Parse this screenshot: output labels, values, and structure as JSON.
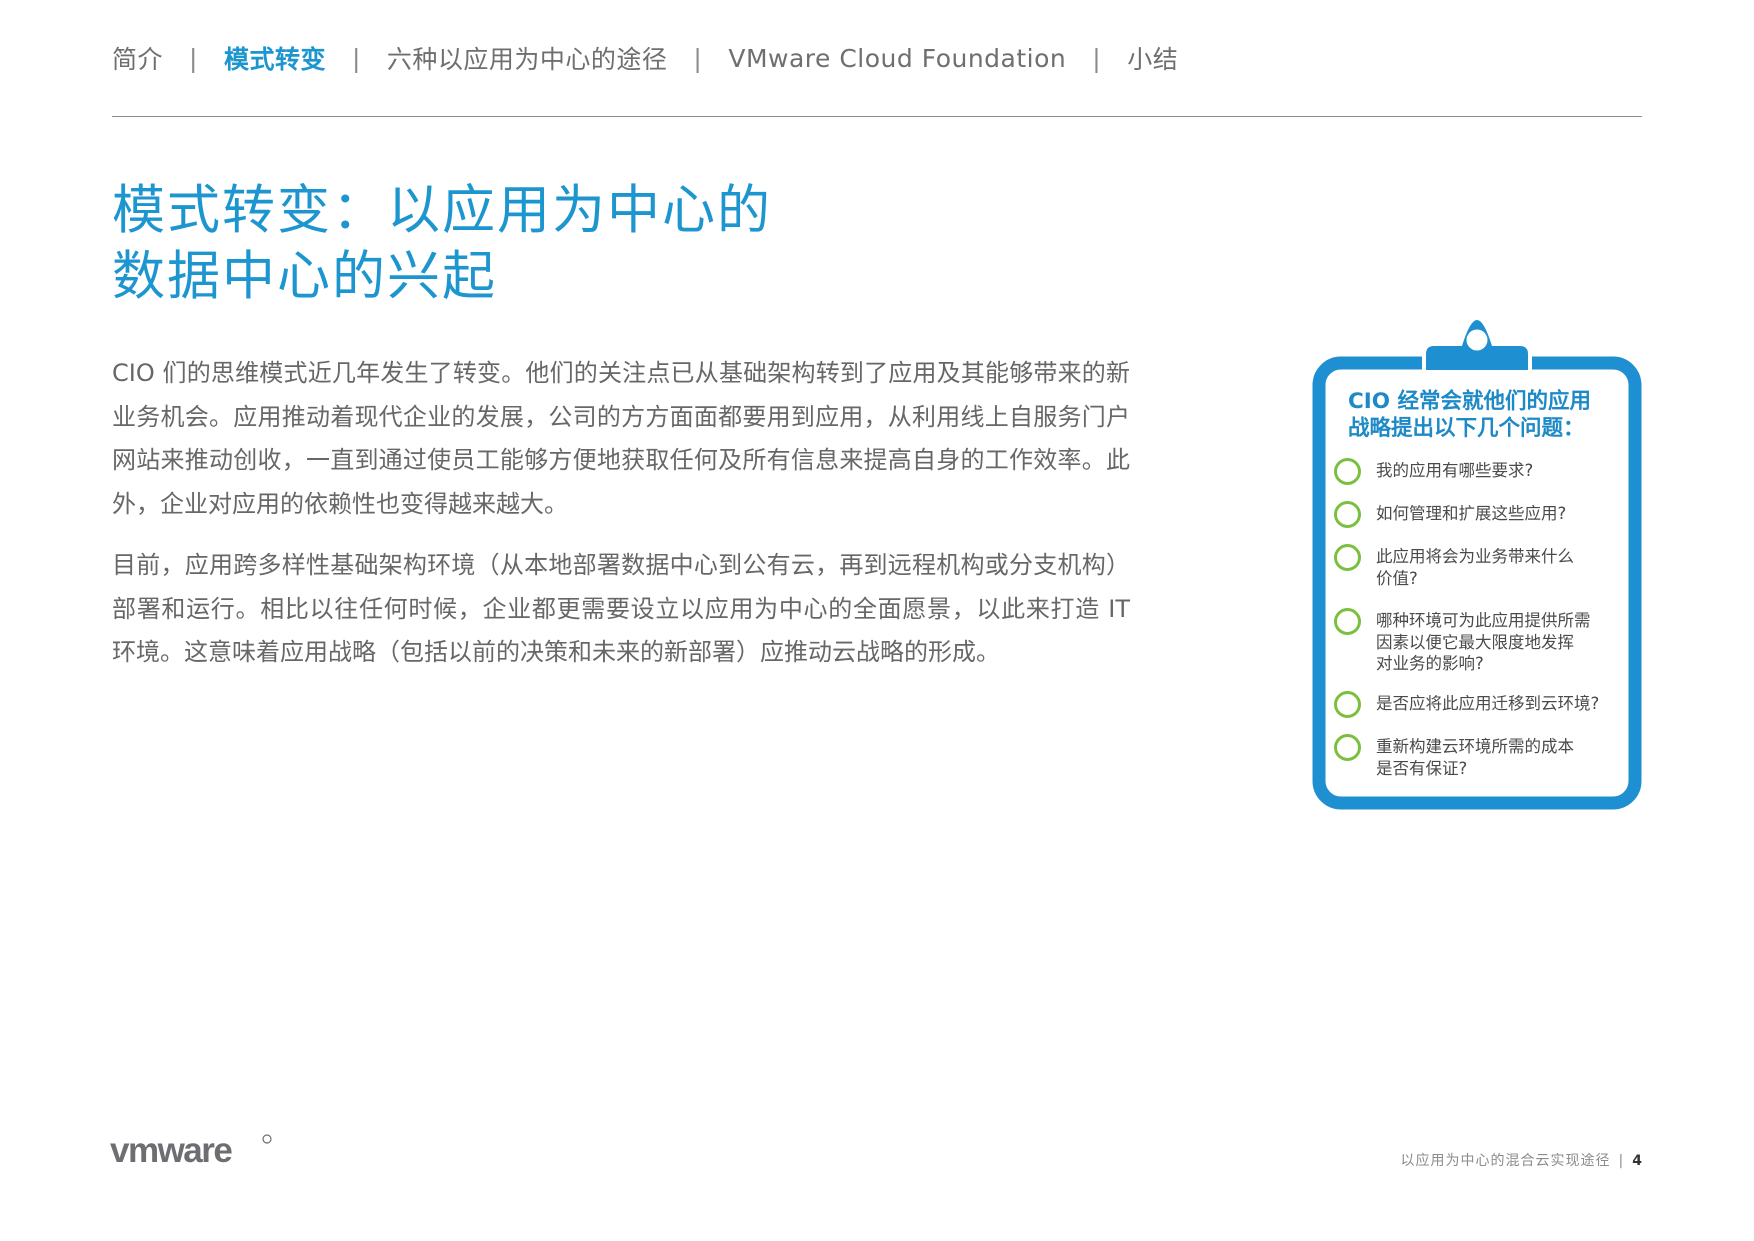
{
  "nav": {
    "items": [
      {
        "label": "简介"
      },
      {
        "label": "模式转变"
      },
      {
        "label": "六种以应用为中心的途径"
      },
      {
        "label": "VMware Cloud Foundation"
      },
      {
        "label": "小结"
      }
    ],
    "separator": "|"
  },
  "title": {
    "line1": "模式转变：以应用为中心的",
    "line2": "数据中心的兴起"
  },
  "body": {
    "p1": "CIO 们的思维模式近几年发生了转变。他们的关注点已从基础架构转到了应用及其能够带来的新业务机会。应用推动着现代企业的发展，公司的方方面面都要用到应用，从利用线上自服务门户网站来推动创收，一直到通过使员工能够方便地获取任何及所有信息来提高自身的工作效率。此外，企业对应用的依赖性也变得越来越大。",
    "p2": "目前，应用跨多样性基础架构环境（从本地部署数据中心到公有云，再到远程机构或分支机构）部署和运行。相比以往任何时候，企业都更需要设立以应用为中心的全面愿景，以此来打造 IT 环境。这意味着应用战略（包括以前的决策和未来的新部署）应推动云战略的形成。"
  },
  "clipboard": {
    "heading_line1": "CIO 经常会就他们的应用",
    "heading_line2": "战略提出以下几个问题：",
    "questions": [
      {
        "line1": "我的应用有哪些要求?",
        "line2": ""
      },
      {
        "line1": "如何管理和扩展这些应用?",
        "line2": ""
      },
      {
        "line1": "此应用将会为业务带来什么",
        "line2": "价值?"
      },
      {
        "line1": "哪种环境可为此应用提供所需",
        "line2": "因素以便它最大限度地发挥",
        "line3": "对业务的影响?"
      },
      {
        "line1": "是否应将此应用迁移到云环境?",
        "line2": ""
      },
      {
        "line1": "重新构建云环境所需的成本",
        "line2": "是否有保证?"
      }
    ]
  },
  "logo": {
    "text": "vmware"
  },
  "footer": {
    "doc_title": "以应用为中心的混合云实现途径",
    "separator": "|",
    "page": "4"
  },
  "colors": {
    "accent": "#1d96d0",
    "clipboard_border": "#1e8fd0",
    "checkbox": "#7bbf3f"
  }
}
